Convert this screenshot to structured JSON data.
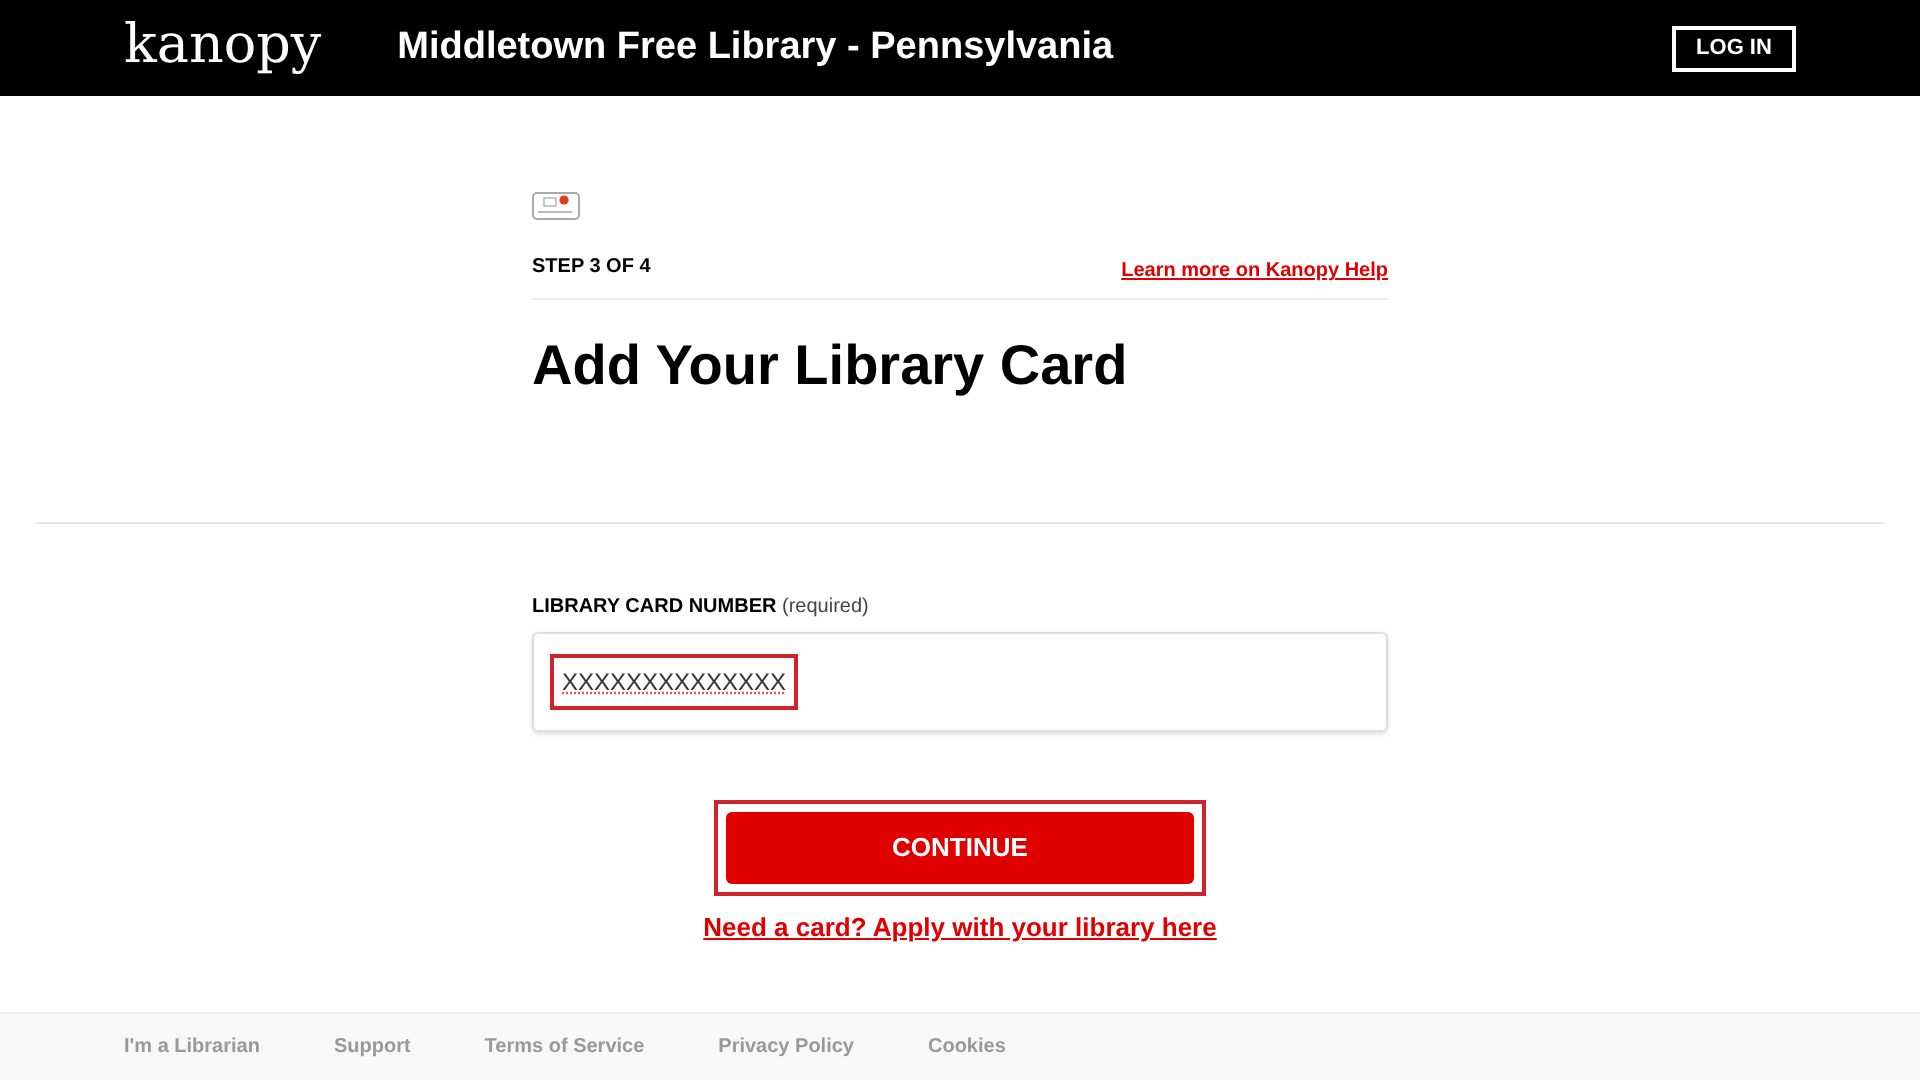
{
  "header": {
    "logo": "kanopy",
    "library": "Middletown Free Library - Pennsylvania",
    "login": "LOG IN"
  },
  "step": {
    "label": "STEP 3 OF 4",
    "help_link": "Learn more on Kanopy Help"
  },
  "heading": "Add Your Library Card",
  "field": {
    "label": "LIBRARY CARD NUMBER",
    "note": "(required)",
    "value": "XXXXXXXXXXXXXX",
    "highlighted": true
  },
  "continue": {
    "label": "CONTINUE",
    "highlighted": true
  },
  "apply_link": "Need a card? Apply with your library here",
  "footer": [
    "I'm a Librarian",
    "Support",
    "Terms of Service",
    "Privacy Policy",
    "Cookies"
  ]
}
